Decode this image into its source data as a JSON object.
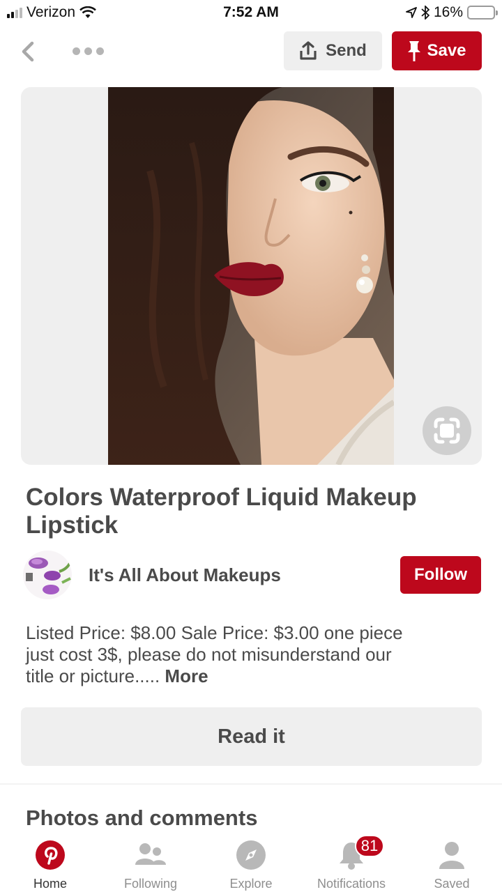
{
  "status_bar": {
    "carrier": "Verizon",
    "time": "7:52 AM",
    "battery": "16%",
    "battery_level": 0.16
  },
  "header": {
    "send_label": "Send",
    "save_label": "Save"
  },
  "pin": {
    "title": "Colors Waterproof Liquid Makeup Lipstick",
    "creator_name": "It's All About Makeups",
    "follow_label": "Follow",
    "description": "Listed Price: $8.00 Sale Price: $3.00 one piece just cost 3$, please do not misunderstand our title or picture.....",
    "more_label": "More",
    "read_label": "Read it"
  },
  "section_title": "Photos and comments",
  "tabs": [
    {
      "label": "Home",
      "icon": "pinterest-logo-icon",
      "active": true
    },
    {
      "label": "Following",
      "icon": "people-icon"
    },
    {
      "label": "Explore",
      "icon": "compass-icon"
    },
    {
      "label": "Notifications",
      "icon": "bell-icon",
      "badge": "81"
    },
    {
      "label": "Saved",
      "icon": "person-icon"
    }
  ],
  "colors": {
    "brand_red": "#bd081c",
    "button_gray": "#efefef",
    "text_dark": "#4a4a4a",
    "tab_inactive": "#8e8e8e"
  }
}
